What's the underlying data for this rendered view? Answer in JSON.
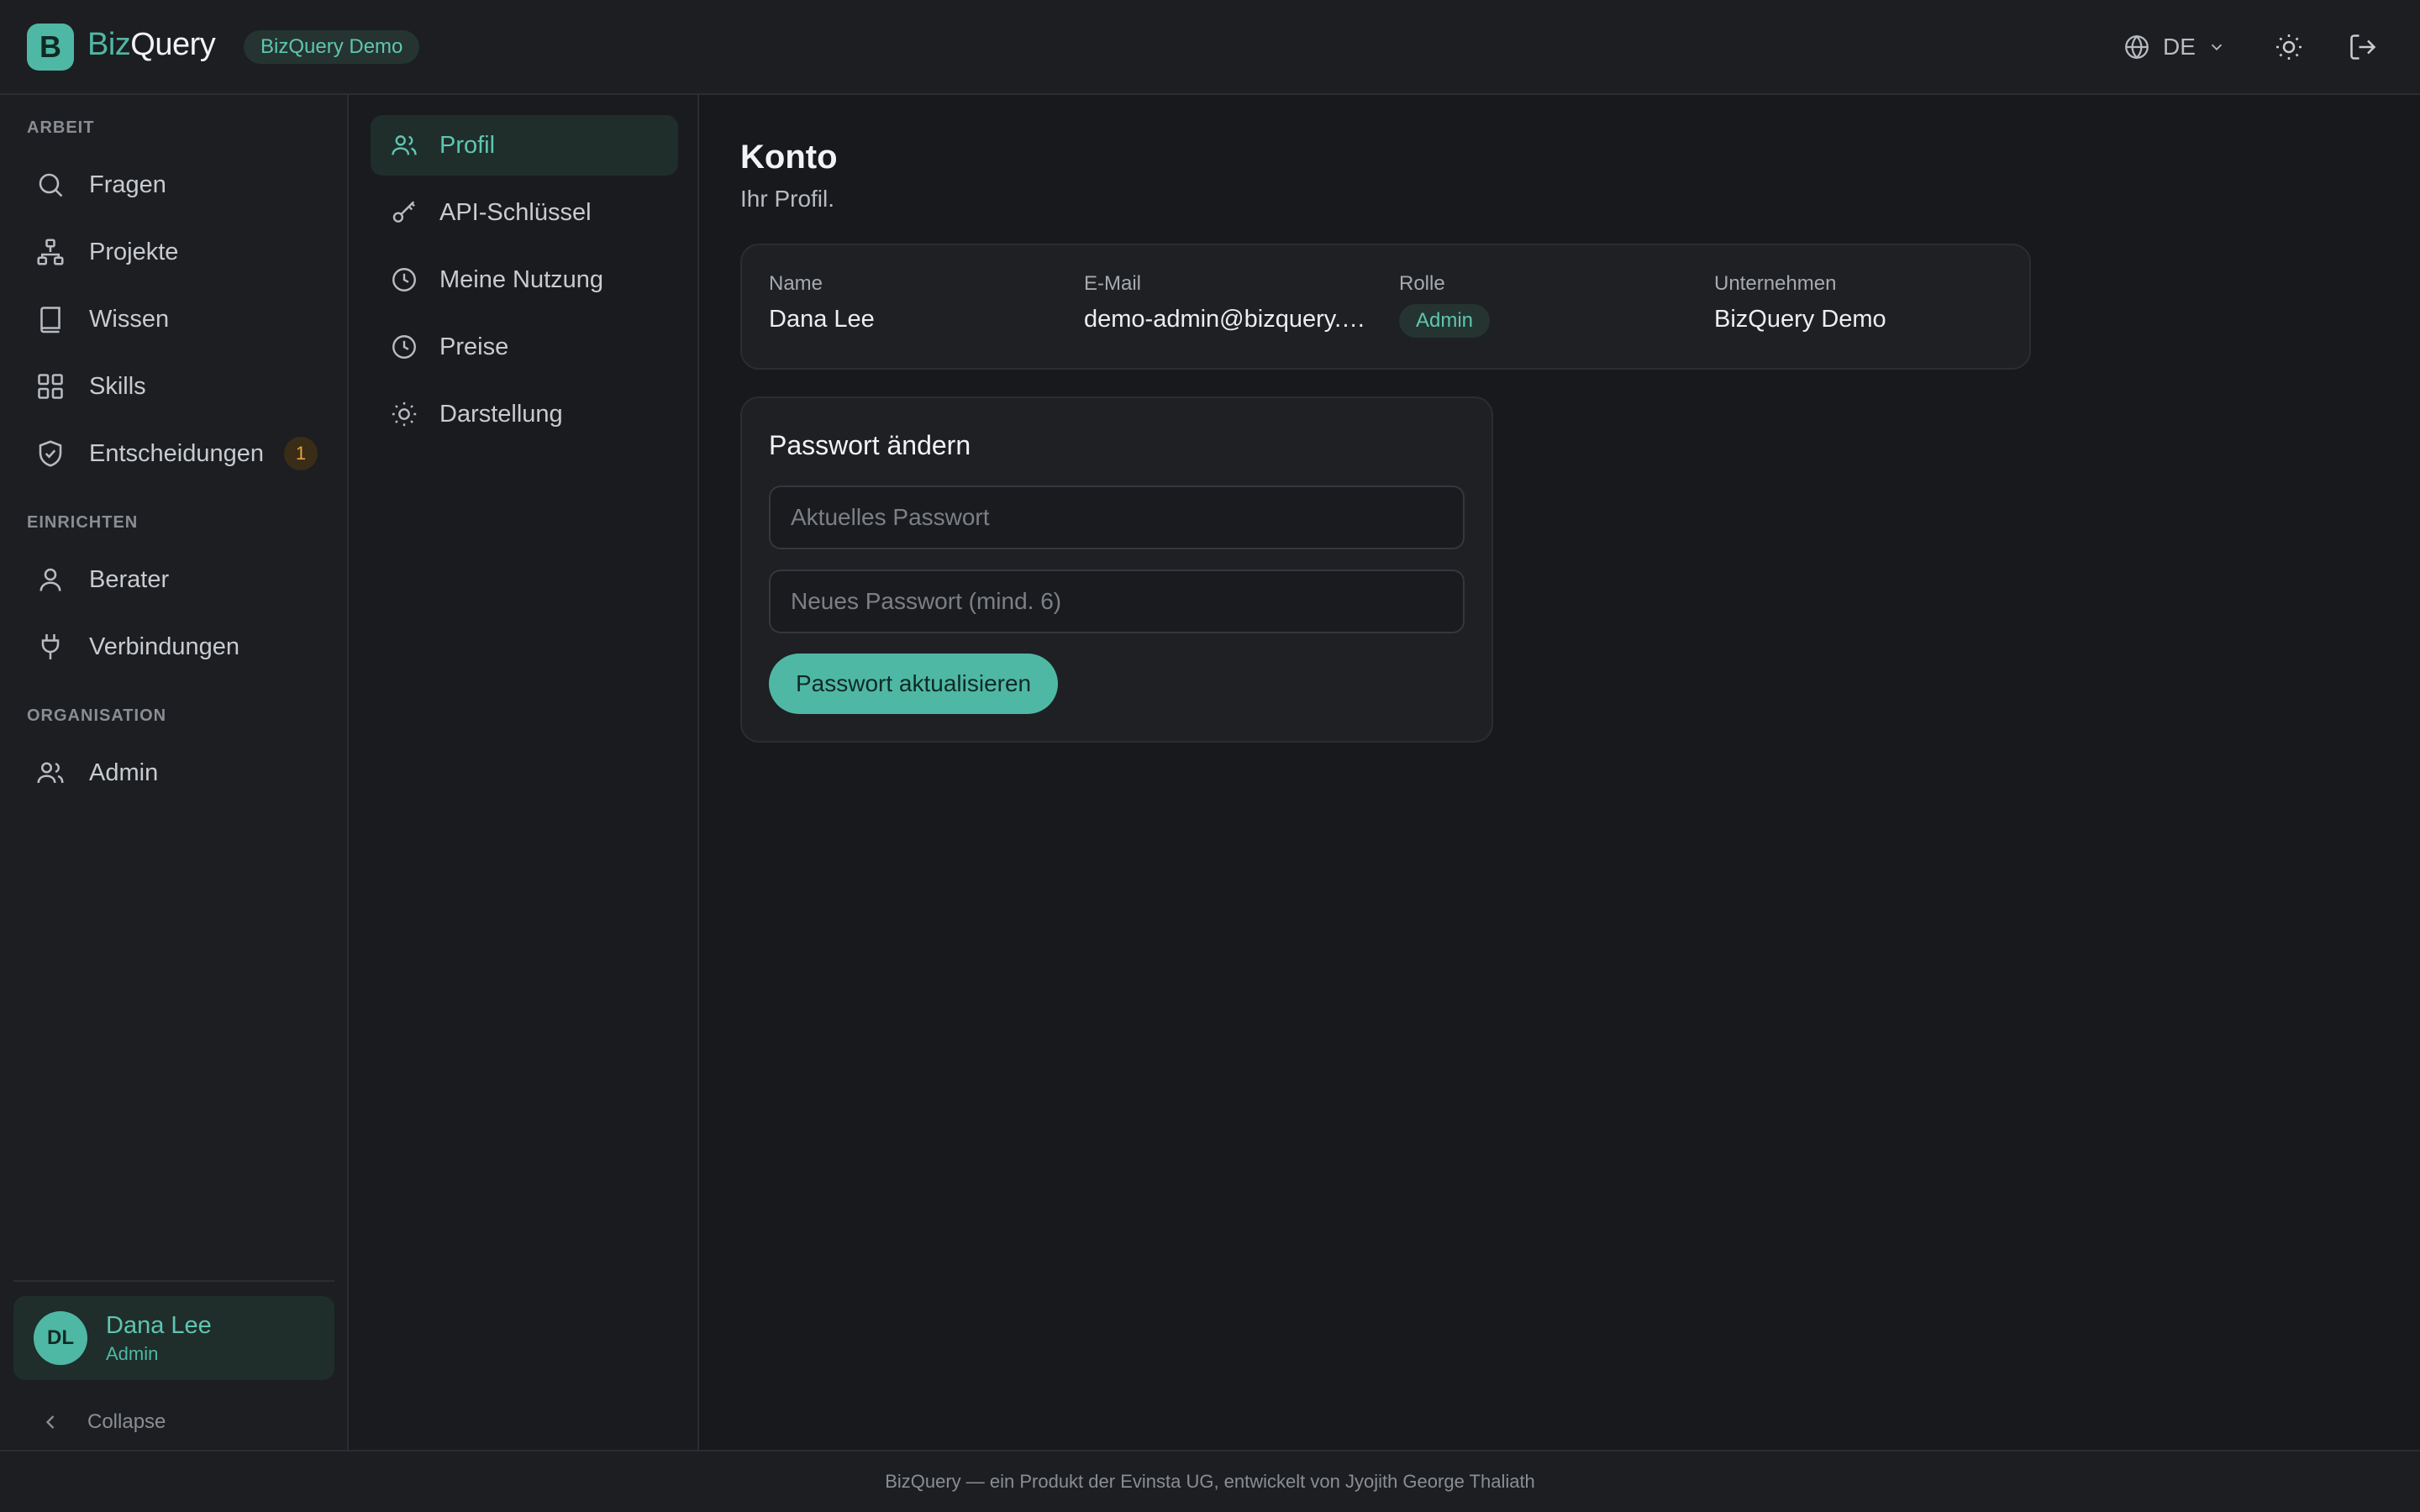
{
  "header": {
    "logo_letter": "B",
    "brand_part1": "Biz",
    "brand_part2": "Query",
    "workspace_badge": "BizQuery Demo",
    "language": "DE",
    "icons": [
      "globe-icon",
      "chevron-down-icon",
      "sun-icon",
      "logout-icon"
    ]
  },
  "sidebar": {
    "sections": {
      "arbeit": "ARBEIT",
      "einrichten": "EINRICHTEN",
      "organisation": "ORGANISATION"
    },
    "items": [
      {
        "label": "Fragen",
        "icon": "search-icon"
      },
      {
        "label": "Projekte",
        "icon": "sitemap-icon"
      },
      {
        "label": "Wissen",
        "icon": "book-icon"
      },
      {
        "label": "Skills",
        "icon": "grid-icon"
      },
      {
        "label": "Entscheidungen",
        "icon": "shield-check-icon",
        "badge": "1"
      },
      {
        "label": "Berater",
        "icon": "user-icon"
      },
      {
        "label": "Verbindungen",
        "icon": "plug-icon"
      },
      {
        "label": "Admin",
        "icon": "users-icon"
      }
    ],
    "user": {
      "initials": "DL",
      "name": "Dana Lee",
      "role": "Admin"
    },
    "collapse_label": "Collapse"
  },
  "subnav": {
    "items": [
      {
        "label": "Profil",
        "icon": "users-icon",
        "active": true
      },
      {
        "label": "API-Schlüssel",
        "icon": "key-icon"
      },
      {
        "label": "Meine Nutzung",
        "icon": "clock-icon"
      },
      {
        "label": "Preise",
        "icon": "clock-icon"
      },
      {
        "label": "Darstellung",
        "icon": "sun-icon"
      }
    ]
  },
  "main": {
    "title": "Konto",
    "subtitle": "Ihr Profil.",
    "profile": {
      "name_label": "Name",
      "name_value": "Dana Lee",
      "email_label": "E-Mail",
      "email_value": "demo-admin@bizquery.com",
      "role_label": "Rolle",
      "role_value": "Admin",
      "company_label": "Unternehmen",
      "company_value": "BizQuery Demo"
    },
    "password": {
      "title": "Passwort ändern",
      "current_placeholder": "Aktuelles Passwort",
      "current_value": "",
      "new_placeholder": "Neues Passwort (mind. 6)",
      "new_value": "",
      "submit_label": "Passwort aktualisieren"
    }
  },
  "footer": {
    "text": "BizQuery — ein Produkt der Evinsta UG, entwickelt von Jyojith George Thaliath"
  },
  "colors": {
    "accent": "#4fb8a4",
    "background": "#18191c",
    "panel": "#1c1e21",
    "warning": "#e3a440"
  }
}
